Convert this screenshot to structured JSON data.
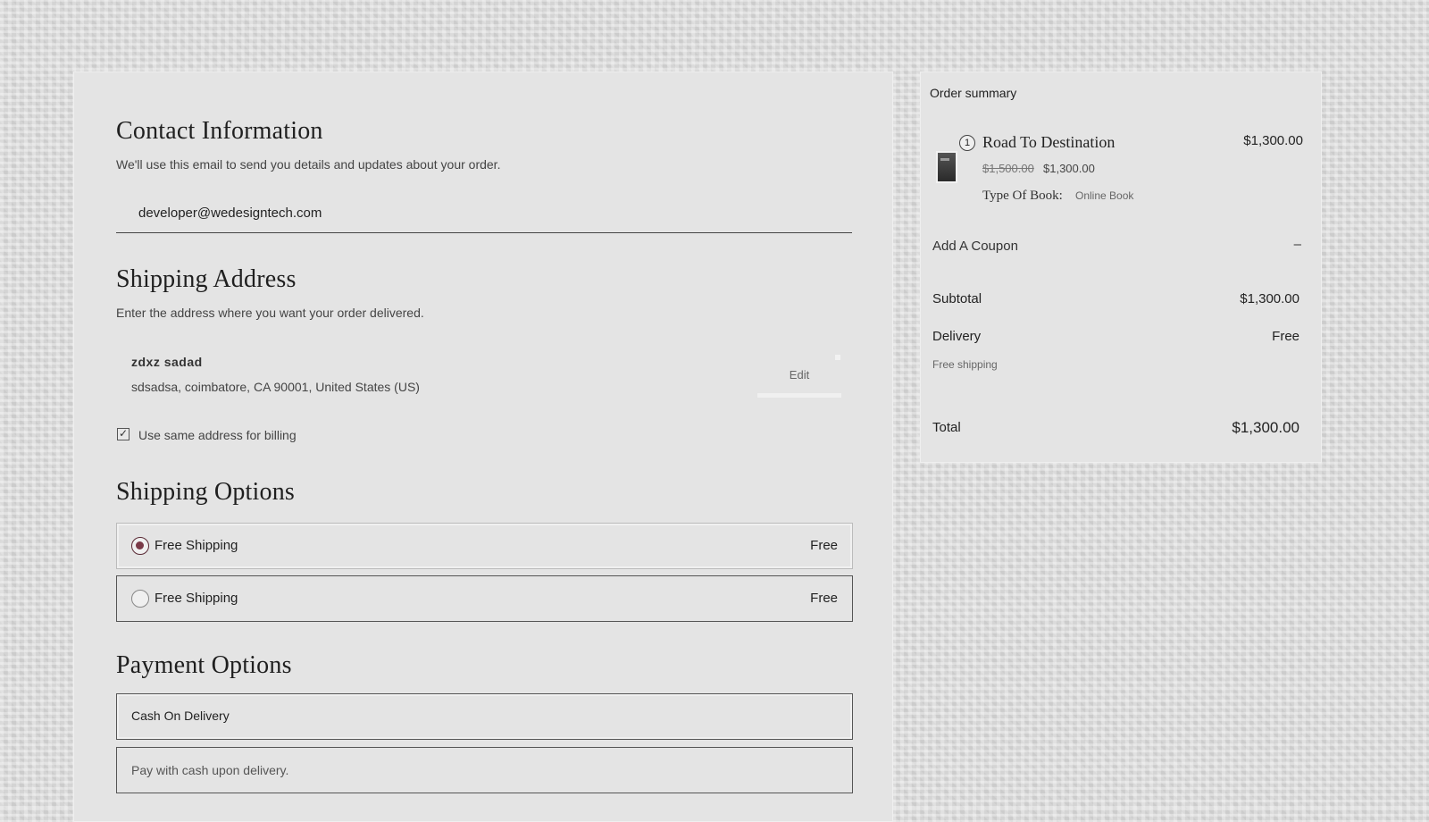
{
  "contact": {
    "title": "Contact Information",
    "subtitle": "We'll use this email to send you details and updates about your order.",
    "email": "developer@wedesigntech.com"
  },
  "shipping_address": {
    "title": "Shipping Address",
    "subtitle": "Enter the address where you want your order delivered.",
    "name": "zdxz sadad",
    "address_line": "sdsadsa, coimbatore, CA 90001, United States (US)",
    "edit_label": "Edit",
    "billing_same_label": "Use same address for billing",
    "billing_same_checked": true
  },
  "shipping_options": {
    "title": "Shipping Options",
    "options": [
      {
        "label": "Free Shipping",
        "price": "Free",
        "selected": true
      },
      {
        "label": "Free Shipping",
        "price": "Free",
        "selected": false
      }
    ]
  },
  "payment_options": {
    "title": "Payment Options",
    "method_label": "Cash On Delivery",
    "method_description": "Pay with cash upon delivery."
  },
  "order_summary": {
    "heading": "Order summary",
    "item": {
      "quantity": "1",
      "name": "Road To Destination",
      "line_total": "$1,300.00",
      "original_price": "$1,500.00",
      "sale_price": "$1,300.00",
      "meta_key": "Type Of Book:",
      "meta_value": "Online Book"
    },
    "coupon_label": "Add A Coupon",
    "coupon_toggle": "–",
    "subtotal_label": "Subtotal",
    "subtotal_value": "$1,300.00",
    "delivery_label": "Delivery",
    "delivery_value": "Free",
    "delivery_note": "Free shipping",
    "total_label": "Total",
    "total_value": "$1,300.00"
  },
  "colors": {
    "radio_accent": "#7a3a48",
    "panel_bg": "#e4e4e4"
  }
}
